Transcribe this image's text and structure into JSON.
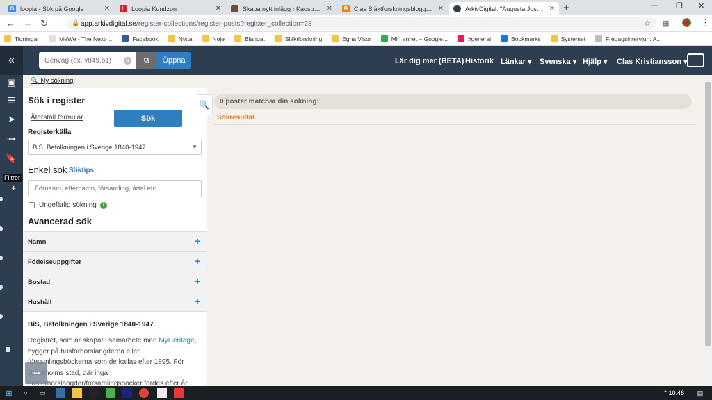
{
  "browser": {
    "tabs": [
      {
        "title": "loopia - Sök på Google",
        "favicon_color": "#4285f4",
        "favicon_letter": "G"
      },
      {
        "title": "Loopia Kundzon",
        "favicon_color": "#c62828",
        "favicon_letter": "L"
      },
      {
        "title": "Skapa nytt inlägg ‹ Kaospensionär",
        "favicon_color": "#6d4c41",
        "favicon_letter": ""
      },
      {
        "title": "Clas Släktforskningsblogg: Gratis",
        "favicon_color": "#f57c00",
        "favicon_letter": "B"
      },
      {
        "title": "ArkivDigital: \"Augusta Josephina",
        "favicon_color": "#2c3e50",
        "favicon_letter": ""
      }
    ],
    "new_tab": "+",
    "url_host": "app.arkivdigital.se",
    "url_path": "/register-collections/register-posts?register_collection=28",
    "bookmarks": [
      {
        "label": "Tidningar",
        "color": "#f6c342"
      },
      {
        "label": "MeWe - The Next-...",
        "color": "#e0e0e0"
      },
      {
        "label": "Facebook",
        "color": "#3b5998"
      },
      {
        "label": "Nytta",
        "color": "#f6c342"
      },
      {
        "label": "Noje",
        "color": "#f6c342"
      },
      {
        "label": "Blandat",
        "color": "#f6c342"
      },
      {
        "label": "Släktforskning",
        "color": "#f6c342"
      },
      {
        "label": "Egna Visor",
        "color": "#f6c342"
      },
      {
        "label": "Min enhet – Google...",
        "color": "#34a853"
      },
      {
        "label": "#general",
        "color": "#e01e5a"
      },
      {
        "label": "Bookmarks",
        "color": "#1a73e8"
      },
      {
        "label": "Systemet",
        "color": "#f6c342"
      },
      {
        "label": "Fredagsintervjun: A...",
        "color": "#bdbdbd"
      }
    ]
  },
  "header": {
    "quick_placeholder": "Genväg (ex. v849.b1)",
    "open_label": "Öppna",
    "nav": [
      "Lär dig mer (BETA)",
      "Historik",
      "Länkar ▾",
      "Svenska ▾",
      "Hjälp ▾",
      "Clas Kristiansson ▾"
    ]
  },
  "rail": {
    "tooltip": "Filtrer"
  },
  "subheader": {
    "new_search": "Ny sökning"
  },
  "panel": {
    "title": "Sök i register",
    "reset": "Återställ formulär",
    "search_button": "Sök",
    "source_label": "Registerkälla",
    "source_value": "BiS, Befolkningen i Sverige 1840-1947",
    "simple_title": "Enkel sök",
    "search_tips": "Söktips",
    "simple_placeholder": "Förnamn, efternamn, församling, årtal etc.",
    "fuzzy_label": "Ungefärlig sökning",
    "advanced_title": "Avancerad sök",
    "accordions": [
      "Namn",
      "Födelseuppgifter",
      "Bostad",
      "Hushåll"
    ],
    "info_title": "BiS, Befolkningen i Sverige 1840-1947",
    "info_before": "Registret, som är skapat i samarbete med ",
    "info_link": "MyHeritage",
    "info_after": ", bygger på husförhörslängderna eller församlingsböckerna som de kallas efter 1895. För Stockholms stad, där inga husförhörslängder/församlingsböcker fördes efter år"
  },
  "results": {
    "count_text": "0 poster matchar din sökning:",
    "heading": "Sökresultat"
  },
  "taskbar": {
    "time": "10:46"
  },
  "colors": {
    "accent": "#2d7fc1",
    "header": "#2c3e50",
    "result_heading": "#e67e22"
  }
}
